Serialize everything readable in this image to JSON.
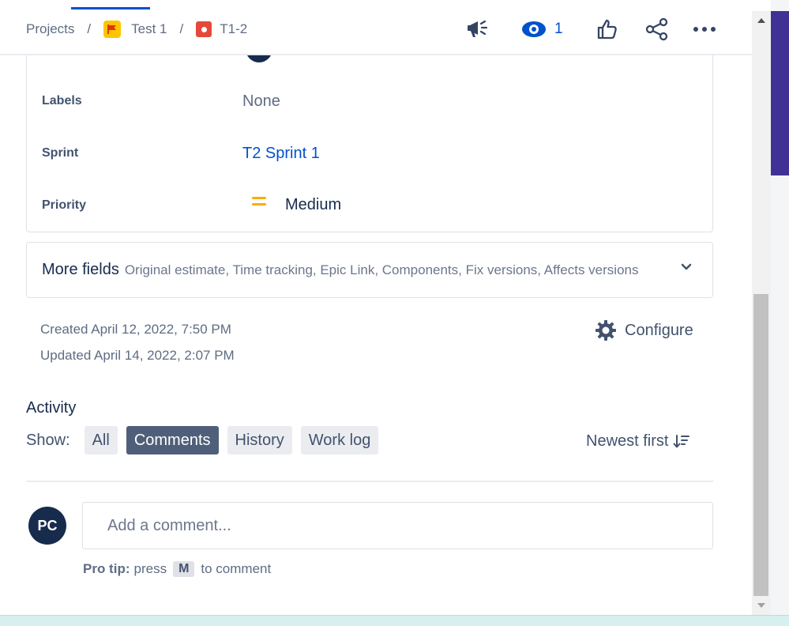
{
  "breadcrumbs": {
    "projects": "Projects",
    "separator": "/",
    "project": "Test 1",
    "issue": "T1-2"
  },
  "header": {
    "watch_count": "1"
  },
  "fields": {
    "labels": {
      "label": "Labels",
      "value": "None"
    },
    "sprint": {
      "label": "Sprint",
      "value": "T2 Sprint 1"
    },
    "priority": {
      "label": "Priority",
      "value": "Medium"
    }
  },
  "more_fields": {
    "title": "More fields",
    "subtitle": "Original estimate, Time tracking, Epic Link, Components, Fix versions, Affects versions"
  },
  "meta": {
    "created": "Created April 12, 2022, 7:50 PM",
    "updated": "Updated April 14, 2022, 2:07 PM",
    "configure": "Configure"
  },
  "activity": {
    "title": "Activity",
    "show_label": "Show:",
    "filters": [
      "All",
      "Comments",
      "History",
      "Work log"
    ],
    "active_filter": "Comments",
    "sort": "Newest first"
  },
  "comment": {
    "avatar_initials": "PC",
    "placeholder": "Add a comment...",
    "protip_bold": "Pro tip:",
    "protip_press": "press",
    "protip_key": "M",
    "protip_suffix": "to comment"
  },
  "colors": {
    "link": "#0052cc",
    "priority_medium": "#ffab00",
    "issue_type": "#e5493a",
    "project_icon": "#ffc400",
    "active_chip": "#505f79"
  },
  "icons": [
    "flag-icon",
    "bug-icon",
    "megaphone-icon",
    "eye-icon",
    "thumbs-up-icon",
    "share-icon",
    "more-icon",
    "chevron-down-icon",
    "gear-icon",
    "sort-icon"
  ]
}
